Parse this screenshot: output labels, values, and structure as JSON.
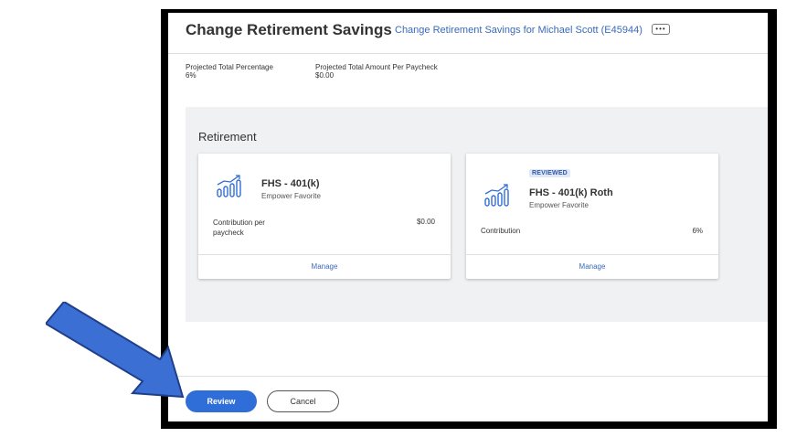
{
  "page": {
    "title": "Change Retirement Savings",
    "subtitle": "Change Retirement Savings for Michael Scott (E45944)",
    "more_glyph": "•••"
  },
  "summary": {
    "percentage_label": "Projected Total Percentage",
    "percentage_value": "6%",
    "amount_label": "Projected Total Amount Per Paycheck",
    "amount_value": "$0.00"
  },
  "section": {
    "title": "Retirement"
  },
  "cards": [
    {
      "name": "FHS - 401(k)",
      "provider": "Empower Favorite",
      "badge": "",
      "contribution_label": "Contribution per paycheck",
      "contribution_value": "$0.00",
      "action": "Manage",
      "icon": "growth-chart-icon"
    },
    {
      "name": "FHS - 401(k) Roth",
      "provider": "Empower Favorite",
      "badge": "REVIEWED",
      "contribution_label": "Contribution",
      "contribution_value": "6%",
      "action": "Manage",
      "icon": "growth-chart-icon"
    }
  ],
  "footer": {
    "primary_button": "Review",
    "secondary_button": "Cancel"
  },
  "colors": {
    "accent": "#2f6ed8",
    "link": "#3a6ab8",
    "badge_bg": "#dfe8f7",
    "section_bg": "#f0f1f3",
    "annotation_arrow": "#3b6fd4",
    "frame": "#000000"
  },
  "annotation": {
    "icon": "pointer-arrow-annotation"
  }
}
